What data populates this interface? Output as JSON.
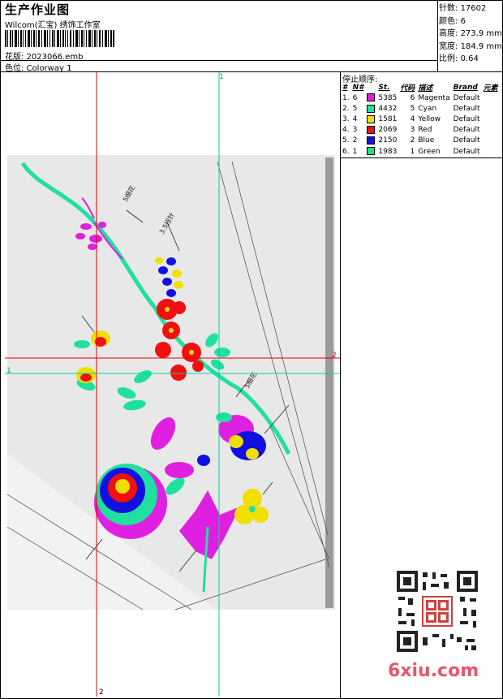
{
  "header": {
    "title": "生产作业图",
    "company": "Wilcom(汇宝) 绣饰工作室",
    "design_label": "花版:",
    "design_file": "2023066.emb",
    "colorway_label": "色位:",
    "colorway": "Colorway 1"
  },
  "stats": [
    {
      "label": "针数:",
      "value": "17602"
    },
    {
      "label": "颜色:",
      "value": "6"
    },
    {
      "label": "高度:",
      "value": "273.9 mm"
    },
    {
      "label": "宽度:",
      "value": "184.9 mm"
    },
    {
      "label": "比例:",
      "value": "0.64"
    }
  ],
  "sequence": {
    "title": "停止顺序:",
    "columns": [
      "#",
      "N#",
      "St.",
      "代码",
      "描述",
      "Brand",
      "元素"
    ],
    "rows": [
      {
        "idx": "1.",
        "n": "6",
        "color": "#e020e0",
        "st": "5385",
        "code": "6",
        "desc": "Magenta",
        "brand": "Default"
      },
      {
        "idx": "2.",
        "n": "5",
        "color": "#20e0a0",
        "st": "4432",
        "code": "5",
        "desc": "Cyan",
        "brand": "Default"
      },
      {
        "idx": "3.",
        "n": "4",
        "color": "#f0e000",
        "st": "1581",
        "code": "4",
        "desc": "Yellow",
        "brand": "Default"
      },
      {
        "idx": "4.",
        "n": "3",
        "color": "#f01010",
        "st": "2069",
        "code": "3",
        "desc": "Red",
        "brand": "Default"
      },
      {
        "idx": "5.",
        "n": "2",
        "color": "#1010e0",
        "st": "2150",
        "code": "2",
        "desc": "Blue",
        "brand": "Default"
      },
      {
        "idx": "6.",
        "n": "1",
        "color": "#20e080",
        "st": "1983",
        "code": "1",
        "desc": "Green",
        "brand": "Default"
      }
    ]
  },
  "guides": {
    "marker_1": "1",
    "marker_2": "2",
    "color_red": "#e00000",
    "color_cyan": "#00d0a0"
  },
  "annotations": {
    "a1": "5细花",
    "a2": "3.5扭针",
    "a3": "5细花"
  },
  "watermark": "6xiu.com"
}
